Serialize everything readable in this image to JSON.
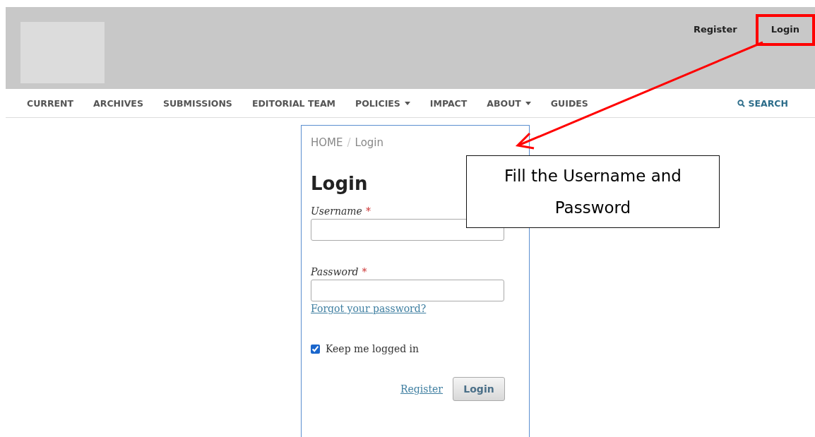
{
  "header": {
    "user_nav": [
      {
        "label": "Register",
        "highlighted": false
      },
      {
        "label": "Login",
        "highlighted": true
      }
    ]
  },
  "nav": {
    "items": [
      {
        "label": "CURRENT",
        "dropdown": false
      },
      {
        "label": "ARCHIVES",
        "dropdown": false
      },
      {
        "label": "SUBMISSIONS",
        "dropdown": false
      },
      {
        "label": "EDITORIAL TEAM",
        "dropdown": false
      },
      {
        "label": "POLICIES",
        "dropdown": true
      },
      {
        "label": "IMPACT",
        "dropdown": false
      },
      {
        "label": "ABOUT",
        "dropdown": true
      },
      {
        "label": "GUIDES",
        "dropdown": false
      }
    ],
    "search": "SEARCH"
  },
  "login": {
    "breadcrumb": {
      "items": [
        "HOME",
        "Login"
      ],
      "separator": "/"
    },
    "title": "Login",
    "fields": [
      {
        "label": "Username",
        "required_mark": "*"
      },
      {
        "label": "Password",
        "required_mark": "*"
      }
    ],
    "forgot_link": "Forgot your password?",
    "remember": {
      "label": "Keep me logged in",
      "checked": true
    },
    "register_link": "Register",
    "submit": "Login"
  },
  "callout": {
    "text": "Fill the Username and Password"
  }
}
